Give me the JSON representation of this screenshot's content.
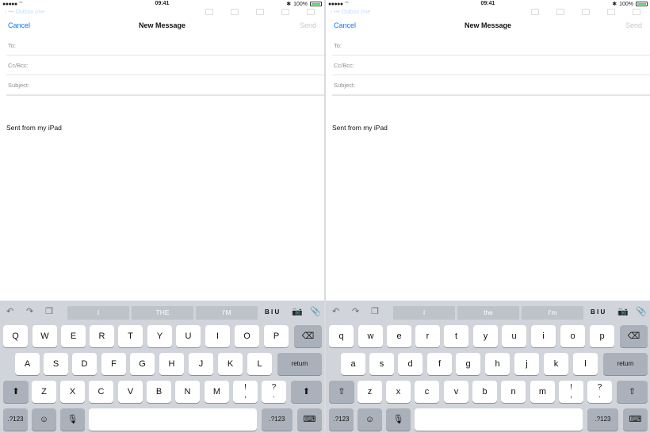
{
  "status": {
    "signal": "●●●●● ⌔",
    "time": "09:41",
    "battery_pct": "100%",
    "bt": "✱"
  },
  "nav": {
    "cancel": "Cancel",
    "title": "New Message",
    "send": "Send",
    "ghost_back": "‹ ••• Outbox (me"
  },
  "fields": {
    "to": "To:",
    "cc": "Cc/Bcc:",
    "subject": "Subject:"
  },
  "body": {
    "signature": "Sent from my iPad"
  },
  "toolbar": {
    "undo_icon": "↶",
    "redo_icon": "↷",
    "paste_icon": "❐",
    "biu": "B I U",
    "camera_icon": "📷",
    "attach_icon": "📎"
  },
  "left": {
    "suggestions": [
      "I",
      "THE",
      "I'M"
    ],
    "row1": [
      "Q",
      "W",
      "E",
      "R",
      "T",
      "Y",
      "U",
      "I",
      "O",
      "P"
    ],
    "row2": [
      "A",
      "S",
      "D",
      "F",
      "G",
      "H",
      "J",
      "K",
      "L"
    ],
    "row3": [
      "Z",
      "X",
      "C",
      "V",
      "B",
      "N",
      "M"
    ],
    "shift_icon": "⬆"
  },
  "right": {
    "suggestions": [
      "I",
      "the",
      "I'm"
    ],
    "row1": [
      "q",
      "w",
      "e",
      "r",
      "t",
      "y",
      "u",
      "i",
      "o",
      "p"
    ],
    "row2": [
      "a",
      "s",
      "d",
      "f",
      "g",
      "h",
      "j",
      "k",
      "l"
    ],
    "row3": [
      "z",
      "x",
      "c",
      "v",
      "b",
      "n",
      "m"
    ],
    "shift_icon": "⇧"
  },
  "keys": {
    "delete_icon": "⌫",
    "return": "return",
    "num": ".?123",
    "emoji_icon": "☺",
    "mic_icon": "🎙",
    "hide_kb_icon": "⌨",
    "p1_top": "!",
    "p1_bot": ",",
    "p2_top": "?",
    "p2_bot": "."
  }
}
